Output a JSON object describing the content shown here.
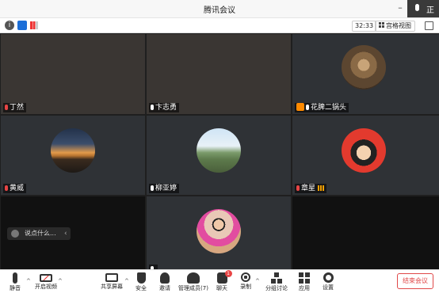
{
  "window": {
    "title": "腾讯会议"
  },
  "side_overlay": {
    "label": "正"
  },
  "topbar": {
    "timer": "32:33",
    "view_label": "宫格视图"
  },
  "participants": [
    {
      "name": "丁然",
      "mic": "muted"
    },
    {
      "name": "卞志勇",
      "mic": "on"
    },
    {
      "name": "花脾二锅头",
      "mic": "on",
      "host": true
    },
    {
      "name": "黄威",
      "mic": "muted"
    },
    {
      "name": "柳亚婷",
      "mic": "on"
    },
    {
      "name": "章星",
      "mic": "muted",
      "speaking": true
    },
    {
      "name": "",
      "mic": "on"
    }
  ],
  "chat": {
    "placeholder": "说点什么..."
  },
  "toolbar": {
    "mute": "静音",
    "video": "开启视频",
    "share": "共享屏幕",
    "security": "安全",
    "invite": "邀请",
    "members": "管理成员(7)",
    "chat": "聊天",
    "chat_badge": "1",
    "record": "录制",
    "breakout": "分组讨论",
    "apps": "应用",
    "settings": "设置",
    "end": "结束会议"
  },
  "colors": {
    "end": "#e04848",
    "host_badge": "#ff8a00",
    "shield": "#1c6fd8"
  }
}
